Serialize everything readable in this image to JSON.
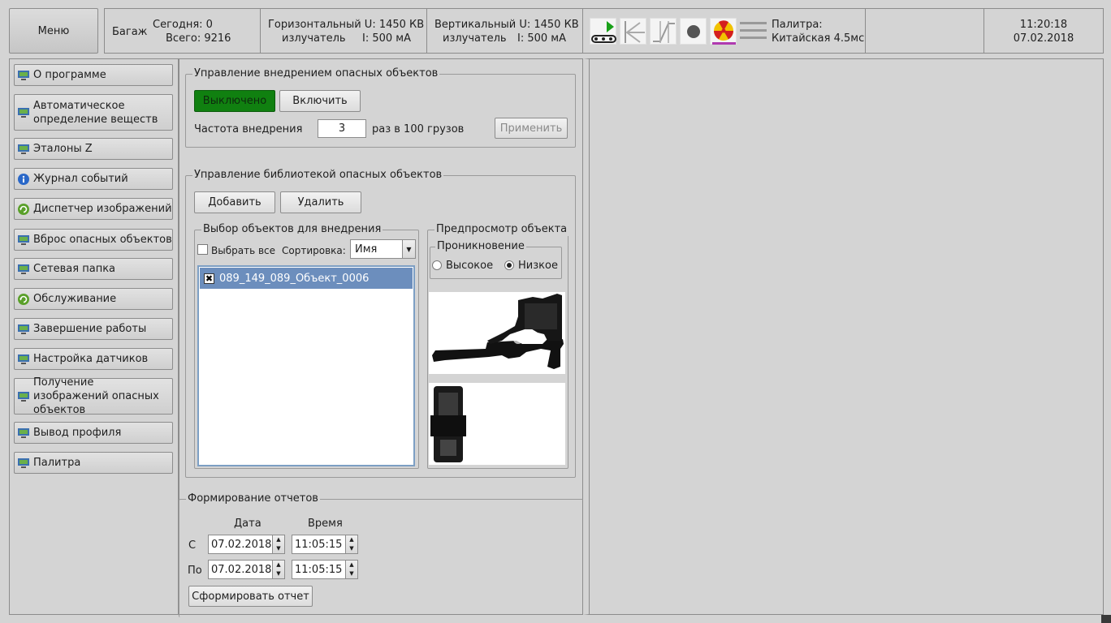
{
  "menu_label": "Меню",
  "topbar": {
    "baggage_label": "Багаж",
    "today": "Сегодня: 0",
    "total": "Всего: 9216",
    "horizontal_line1": "Горизонтальный U: 1450 КВ",
    "horizontal_line2_left": "излучатель",
    "horizontal_line2_right": "I: 500 мА",
    "vertical_line1": "Вертикальный U: 1450 КВ",
    "vertical_line2_left": "излучатель",
    "vertical_line2_right": "I: 500 мА",
    "icons": [
      "conveyor-play-icon",
      "edge-enhance-icon",
      "contrast-curve-icon",
      "record-dot-icon",
      "radiation-icon",
      "menu-lines-icon"
    ],
    "palette_label": "Палитра:",
    "palette_value": "Китайская 4.5мс",
    "time": "11:20:18",
    "date": "07.02.2018"
  },
  "sidebar": {
    "items": [
      {
        "label": "О программе",
        "icon": "monitor-icon"
      },
      {
        "label": "Автоматическое определение веществ",
        "icon": "monitor-icon"
      },
      {
        "label": "Эталоны Z",
        "icon": "monitor-icon"
      },
      {
        "label": "Журнал событий",
        "icon": "info-icon"
      },
      {
        "label": "Диспетчер изображений",
        "icon": "refresh-icon"
      },
      {
        "label": "Вброс опасных объектов",
        "icon": "monitor-icon"
      },
      {
        "label": "Сетевая папка",
        "icon": "monitor-icon"
      },
      {
        "label": "Обслуживание",
        "icon": "refresh-icon"
      },
      {
        "label": "Завершение работы",
        "icon": "monitor-icon"
      },
      {
        "label": "Настройка датчиков",
        "icon": "monitor-icon"
      },
      {
        "label": "Получение изображений опасных объектов",
        "icon": "monitor-icon"
      },
      {
        "label": "Вывод профиля",
        "icon": "monitor-icon"
      },
      {
        "label": "Палитра",
        "icon": "monitor-icon"
      }
    ]
  },
  "injection": {
    "title": "Управление внедрением опасных объектов",
    "state_off": "Выключено",
    "enable_button": "Включить",
    "frequency_label": "Частота внедрения",
    "frequency_value": "3",
    "frequency_suffix": "раз в 100 грузов",
    "apply_button": "Применить"
  },
  "library": {
    "title": "Управление библиотекой опасных объектов",
    "add_button": "Добавить",
    "delete_button": "Удалить",
    "selection": {
      "title": "Выбор объектов для внедрения",
      "select_all": "Выбрать все",
      "sort_label": "Сортировка:",
      "sort_value": "Имя",
      "items": [
        {
          "name": "089_149_089_Объект_0006",
          "checked": true
        }
      ]
    },
    "preview": {
      "title": "Предпросмотр объекта",
      "penetration_title": "Проникновение",
      "high": "Высокое",
      "low": "Низкое",
      "selected": "Низкое"
    }
  },
  "reports": {
    "title": "Формирование отчетов",
    "date_header": "Дата",
    "time_header": "Время",
    "from_label": "С",
    "to_label": "По",
    "from_date": "07.02.2018",
    "from_time": "11:05:15",
    "to_date": "07.02.2018",
    "to_time": "11:05:15",
    "generate_button": "Сформировать отчет"
  },
  "colors": {
    "accent_green": "#108010",
    "selection_blue": "#6c8ebd",
    "radiation_yellow": "#f2c200",
    "radiation_red": "#d41f1f"
  }
}
